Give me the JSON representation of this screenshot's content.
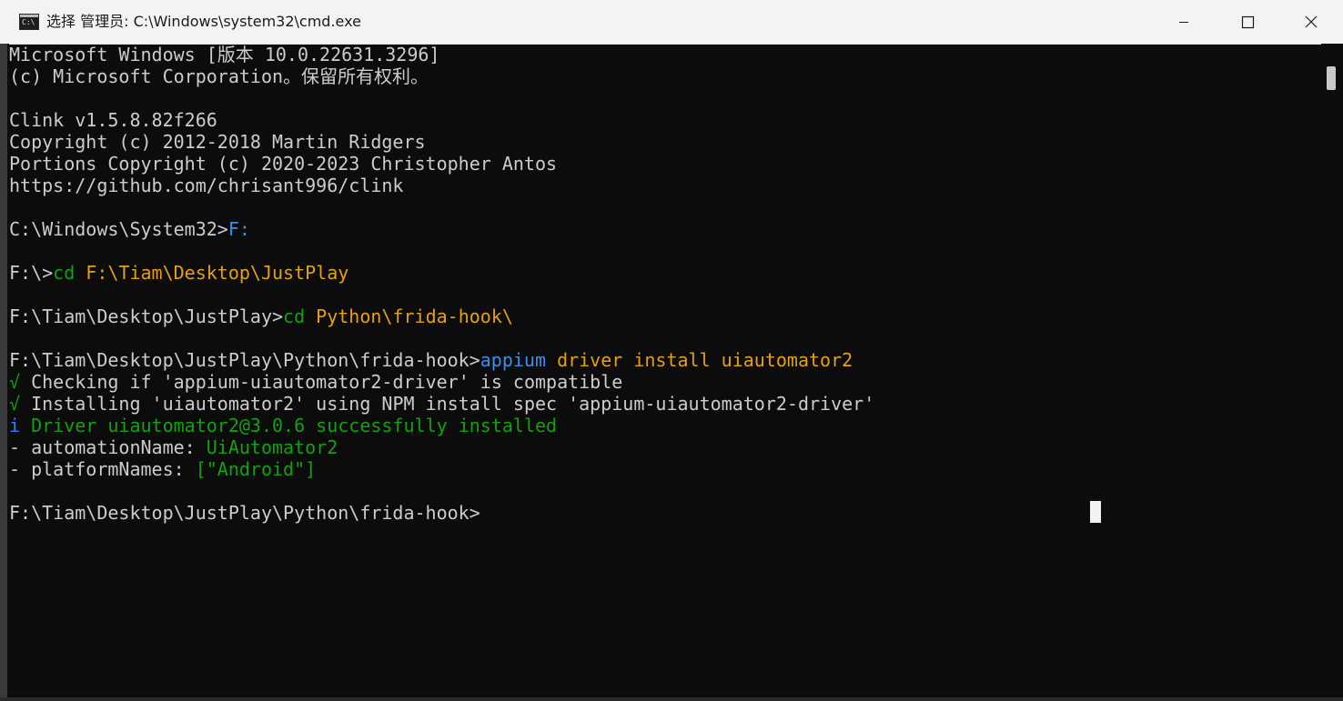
{
  "window": {
    "title": "选择 管理员: C:\\Windows\\system32\\cmd.exe",
    "icon_label": "C:\\",
    "controls": {
      "minimize": "minimize-icon",
      "maximize": "maximize-icon",
      "close": "close-icon"
    }
  },
  "colors": {
    "background": "#0c0c0c",
    "default_text": "#cccccc",
    "command_blue": "#3b8eea",
    "path_yellow": "#e5a00d",
    "success_green": "#13a10e",
    "info_blue": "#3b78ff",
    "titlebar": "#f3f3f3"
  },
  "console": {
    "lines": [
      [
        {
          "text": "Microsoft Windows [版本 10.0.22631.3296]",
          "color": "w"
        }
      ],
      [
        {
          "text": "(c) Microsoft Corporation。保留所有权利。",
          "color": "w"
        }
      ],
      [],
      [
        {
          "text": "Clink v1.5.8.82f266",
          "color": "w"
        }
      ],
      [
        {
          "text": "Copyright (c) 2012-2018 Martin Ridgers",
          "color": "w"
        }
      ],
      [
        {
          "text": "Portions Copyright (c) 2020-2023 Christopher Antos",
          "color": "w"
        }
      ],
      [
        {
          "text": "https://github.com/chrisant996/clink",
          "color": "w"
        }
      ],
      [],
      [
        {
          "text": "C:\\Windows\\System32>",
          "color": "w"
        },
        {
          "text": "F:",
          "color": "b"
        }
      ],
      [],
      [
        {
          "text": "F:\\>",
          "color": "w"
        },
        {
          "text": "cd ",
          "color": "g"
        },
        {
          "text": "F:\\Tiam\\Desktop\\JustPlay",
          "color": "y"
        }
      ],
      [],
      [
        {
          "text": "F:\\Tiam\\Desktop\\JustPlay>",
          "color": "w"
        },
        {
          "text": "cd ",
          "color": "g"
        },
        {
          "text": "Python\\frida-hook\\",
          "color": "y"
        }
      ],
      [],
      [
        {
          "text": "F:\\Tiam\\Desktop\\JustPlay\\Python\\frida-hook>",
          "color": "w"
        },
        {
          "text": "appium ",
          "color": "b"
        },
        {
          "text": "driver install uiautomator2",
          "color": "y"
        }
      ],
      [
        {
          "text": "√ ",
          "color": "g"
        },
        {
          "text": "Checking if 'appium-uiautomator2-driver' is compatible",
          "color": "w"
        }
      ],
      [
        {
          "text": "√ ",
          "color": "g"
        },
        {
          "text": "Installing 'uiautomator2' using NPM install spec 'appium-uiautomator2-driver'",
          "color": "w"
        }
      ],
      [
        {
          "text": "i ",
          "color": "bi"
        },
        {
          "text": "Driver uiautomator2@3.0.6 successfully installed",
          "color": "g"
        }
      ],
      [
        {
          "text": "- automationName: ",
          "color": "w"
        },
        {
          "text": "UiAutomator2",
          "color": "g"
        }
      ],
      [
        {
          "text": "- platformNames: ",
          "color": "w"
        },
        {
          "text": "[\"Android\"]",
          "color": "g"
        }
      ],
      [],
      [
        {
          "text": "F:\\Tiam\\Desktop\\JustPlay\\Python\\frida-hook>",
          "color": "w"
        }
      ]
    ]
  }
}
